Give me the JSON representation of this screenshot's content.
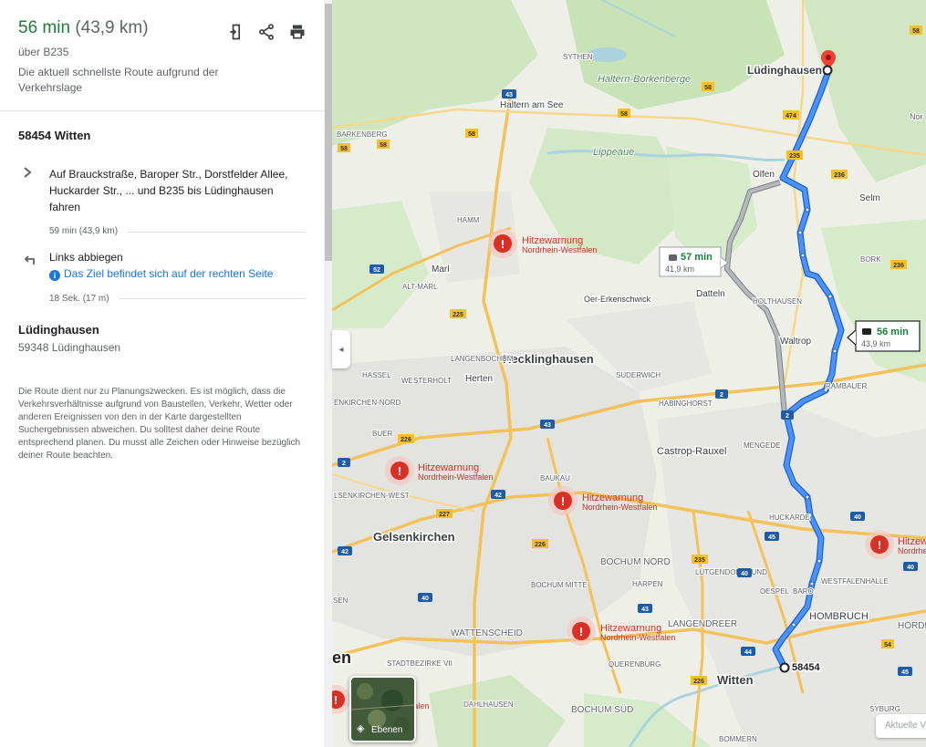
{
  "panel": {
    "time": "56 min",
    "distance": "(43,9 km)",
    "via": "über B235",
    "description": "Die aktuell schnellste Route aufgrund der Verkehrslage",
    "start": "58454 Witten",
    "steps": [
      {
        "text": "Auf Brauckstraße, Baroper Str., Dorstfelder Allee, Huckarder Str., ... und B235 bis Lüdinghausen fahren",
        "info": "59 min (43,9 km)",
        "icon": "chevron-right-icon"
      },
      {
        "text": "Links abbiegen",
        "note": "Das Ziel befindet sich auf der rechten Seite",
        "info": "18 Sek. (17 m)",
        "icon": "turn-left-icon"
      }
    ],
    "destination": {
      "name": "Lüdinghausen",
      "address": "59348 Lüdinghausen"
    },
    "disclaimer": "Die Route dient nur zu Planungszwecken. Es ist möglich, dass die Verkehrsverhältnisse aufgrund von Baustellen, Verkehr, Wetter oder anderen Ereignissen von den in der Karte dargestellten Suchergebnissen abweichen. Du solltest daher deine Route entsprechend planen. Du musst alle Zeichen oder Hinweise bezüglich deiner Route beachten.",
    "icons": [
      "send-to-phone-icon",
      "share-icon",
      "print-icon"
    ]
  },
  "map": {
    "route_main": {
      "time": "56 min",
      "distance": "43,9 km"
    },
    "route_alt": {
      "time": "57 min",
      "distance": "41,9 km"
    },
    "origin_label": "58454",
    "destination_label": "Lüdinghausen",
    "warning_title": "Hitzewarnung",
    "warning_region": "Nordrhein-Westfalen",
    "cities": [
      "Recklinghausen",
      "Gelsenkirchen",
      "Witten",
      "Lüdinghausen",
      "Castrop-Rauxel",
      "Haltern am See",
      "Marl",
      "Herten",
      "Datteln",
      "Olfen",
      "Selm",
      "Waltrop",
      "HOMBRUCH",
      "Oer-Erkenschwick",
      "Haltern-Borkenberge",
      "Lippeaue"
    ],
    "small_places": [
      "SYTHEN",
      "HAMM",
      "ALT-MARL",
      "LANGENBOCHUM",
      "HASSEL",
      "WESTERHOLT",
      "SUDERWICH",
      "HABINGHORST",
      "HOLTHAUSEN",
      "RAMBAUER",
      "MENGEDE",
      "BAUKAU",
      "BUER",
      "HUCKARDE",
      "BOCHUM NORD",
      "HARPEN",
      "BOCHUM MITTE",
      "LÜTGENDORTMUND",
      "OESPEL",
      "BARO",
      "WESTFALENHALLE",
      "LANGENDREER",
      "WATTENSCHEID",
      "QUERENBURG",
      "DAHLHAUSEN",
      "BOCHUM SÜD",
      "STADTBEZIRKE VII",
      "SYBURG",
      "BOMMERN",
      "BORK",
      "BARKENBERG",
      "HÖRDE"
    ],
    "partial_labels": [
      "ENKIRCHEN-NORD",
      "LSENKIRCHEN-WEST",
      "SEN",
      "en",
      "Nor"
    ],
    "layers_label": "Ebenen",
    "traffic_label": "Aktuelle V",
    "colors": {
      "route": "#1a73e8",
      "alt_route": "#9aa0a6",
      "time_green": "#188038",
      "warning": "#d93025"
    }
  }
}
